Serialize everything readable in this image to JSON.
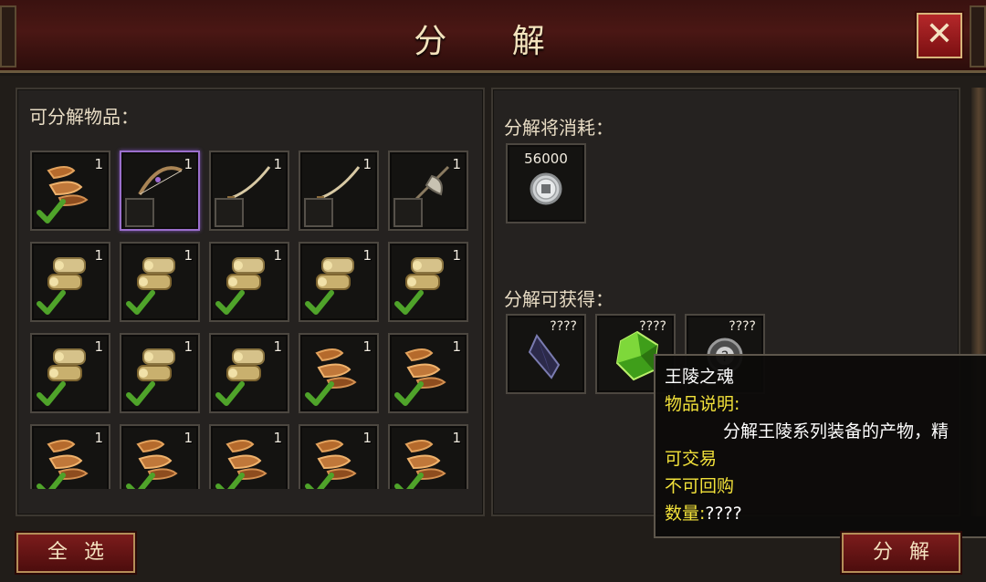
{
  "window": {
    "title": "分 解",
    "close_label": "✕"
  },
  "left_panel": {
    "label": "可分解物品：",
    "items": [
      {
        "icon": "sandals-icon",
        "count": "1",
        "checked": true,
        "selected": false
      },
      {
        "icon": "bow-icon",
        "count": "1",
        "checked": false,
        "selected": true
      },
      {
        "icon": "blade-icon",
        "count": "1",
        "checked": false,
        "selected": false
      },
      {
        "icon": "blade-icon",
        "count": "1",
        "checked": false,
        "selected": false
      },
      {
        "icon": "axe-icon",
        "count": "1",
        "checked": false,
        "selected": false
      },
      {
        "icon": "bracer-icon",
        "count": "1",
        "checked": true,
        "selected": false
      },
      {
        "icon": "bracer-icon",
        "count": "1",
        "checked": true,
        "selected": false
      },
      {
        "icon": "bracer-icon",
        "count": "1",
        "checked": true,
        "selected": false
      },
      {
        "icon": "bracer-icon",
        "count": "1",
        "checked": true,
        "selected": false
      },
      {
        "icon": "bracer-icon",
        "count": "1",
        "checked": true,
        "selected": false
      },
      {
        "icon": "bracer-icon",
        "count": "1",
        "checked": true,
        "selected": false
      },
      {
        "icon": "bracer-icon",
        "count": "1",
        "checked": true,
        "selected": false
      },
      {
        "icon": "bracer-icon",
        "count": "1",
        "checked": true,
        "selected": false
      },
      {
        "icon": "sandals-icon",
        "count": "1",
        "checked": true,
        "selected": false
      },
      {
        "icon": "sandals-icon",
        "count": "1",
        "checked": true,
        "selected": false
      },
      {
        "icon": "sandals-icon",
        "count": "1",
        "checked": true,
        "selected": false
      },
      {
        "icon": "sandals-icon",
        "count": "1",
        "checked": true,
        "selected": false
      },
      {
        "icon": "sandals-icon",
        "count": "1",
        "checked": true,
        "selected": false
      },
      {
        "icon": "sandals-icon",
        "count": "1",
        "checked": true,
        "selected": false
      },
      {
        "icon": "sandals-icon",
        "count": "1",
        "checked": true,
        "selected": false
      }
    ]
  },
  "right_panel": {
    "cost_label": "分解将消耗：",
    "cost": {
      "icon": "silver-coin-icon",
      "value": "56000"
    },
    "gain_label": "分解可获得：",
    "gains": [
      {
        "icon": "dark-crystal-icon",
        "count": "????"
      },
      {
        "icon": "green-gem-icon",
        "count": "????"
      },
      {
        "icon": "mystery-orb-icon",
        "count": "????"
      }
    ]
  },
  "tooltip": {
    "name": "王陵之魂",
    "desc_title": "物品说明:",
    "desc": "分解王陵系列装备的产物，精",
    "tradable": "可交易",
    "no_buyback": "不可回购",
    "quantity_label": "数量:",
    "quantity_value": "????"
  },
  "buttons": {
    "select_all": "全选",
    "decompose": "分解"
  },
  "colors": {
    "accent_red": "#7c1c1c",
    "gold_border": "#b48e58",
    "tooltip_yellow": "#f2e13a"
  }
}
